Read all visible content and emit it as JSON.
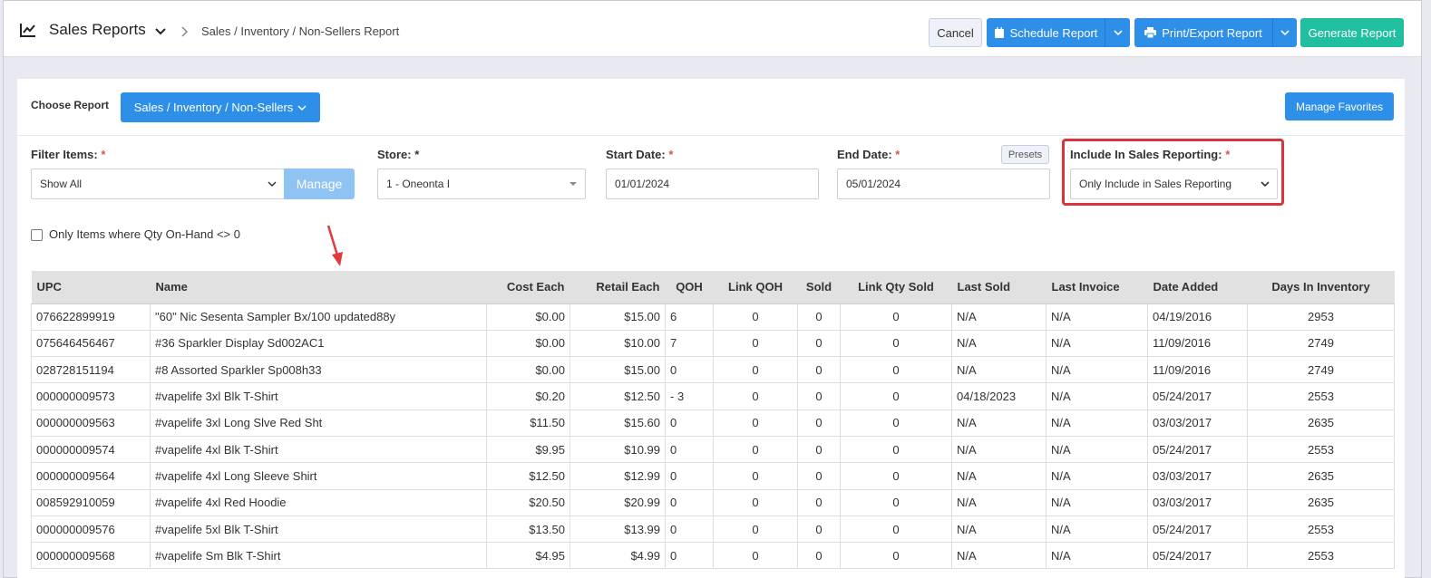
{
  "header": {
    "title": "Sales Reports",
    "breadcrumb": "Sales / Inventory / Non-Sellers Report",
    "cancel_label": "Cancel",
    "schedule_label": "Schedule Report",
    "print_label": "Print/Export Report",
    "generate_label": "Generate Report"
  },
  "report": {
    "choose_label": "Choose Report",
    "selected_report": "Sales / Inventory / Non-Sellers",
    "manage_favorites_label": "Manage Favorites"
  },
  "filters": {
    "filter_items_label": "Filter Items:",
    "filter_items_value": "Show All",
    "manage_label": "Manage",
    "store_label": "Store:",
    "store_value": "1 - Oneonta I",
    "start_date_label": "Start Date:",
    "start_date_value": "01/01/2024",
    "end_date_label": "End Date:",
    "end_date_value": "05/01/2024",
    "presets_label": "Presets",
    "include_label": "Include In Sales Reporting:",
    "include_value": "Only Include in Sales Reporting",
    "required_mark": "*",
    "qty_checkbox_label": "Only Items where Qty On-Hand <> 0"
  },
  "colors": {
    "primary": "#2d8fe7",
    "generate": "#1fbf9f",
    "highlight": "#d8343d"
  },
  "table": {
    "columns": [
      "UPC",
      "Name",
      "Cost Each",
      "Retail Each",
      "QOH",
      "Link QOH",
      "Sold",
      "Link Qty Sold",
      "Last Sold",
      "Last Invoice",
      "Date Added",
      "Days In Inventory"
    ],
    "rows": [
      [
        "076622899919",
        "\"60\" Nic Sesenta Sampler Bx/100 updated88y",
        "$0.00",
        "$15.00",
        "6",
        "0",
        "0",
        "0",
        "N/A",
        "N/A",
        "04/19/2016",
        "2953"
      ],
      [
        "075646456467",
        "#36 Sparkler Display Sd002AC1",
        "$0.00",
        "$10.00",
        "7",
        "0",
        "0",
        "0",
        "N/A",
        "N/A",
        "11/09/2016",
        "2749"
      ],
      [
        "028728151194",
        "#8 Assorted Sparkler Sp008h33",
        "$0.00",
        "$15.00",
        "0",
        "0",
        "0",
        "0",
        "N/A",
        "N/A",
        "11/09/2016",
        "2749"
      ],
      [
        "000000009573",
        "#vapelife 3xl Blk T-Shirt",
        "$0.20",
        "$12.50",
        "- 3",
        "0",
        "0",
        "0",
        "04/18/2023",
        "N/A",
        "05/24/2017",
        "2553"
      ],
      [
        "000000009563",
        "#vapelife 3xl Long Slve Red Sht",
        "$11.50",
        "$15.60",
        "0",
        "0",
        "0",
        "0",
        "N/A",
        "N/A",
        "03/03/2017",
        "2635"
      ],
      [
        "000000009574",
        "#vapelife 4xl Blk T-Shirt",
        "$9.95",
        "$10.99",
        "0",
        "0",
        "0",
        "0",
        "N/A",
        "N/A",
        "05/24/2017",
        "2553"
      ],
      [
        "000000009564",
        "#vapelife 4xl Long Sleeve Shirt",
        "$12.50",
        "$12.99",
        "0",
        "0",
        "0",
        "0",
        "N/A",
        "N/A",
        "03/03/2017",
        "2635"
      ],
      [
        "008592910059",
        "#vapelife 4xl Red Hoodie",
        "$20.50",
        "$20.99",
        "0",
        "0",
        "0",
        "0",
        "N/A",
        "N/A",
        "03/03/2017",
        "2635"
      ],
      [
        "000000009576",
        "#vapelife 5xl Blk T-Shirt",
        "$13.50",
        "$13.99",
        "0",
        "0",
        "0",
        "0",
        "N/A",
        "N/A",
        "05/24/2017",
        "2553"
      ],
      [
        "000000009568",
        "#vapelife Sm Blk T-Shirt",
        "$4.95",
        "$4.99",
        "0",
        "0",
        "0",
        "0",
        "N/A",
        "N/A",
        "05/24/2017",
        "2553"
      ]
    ]
  }
}
